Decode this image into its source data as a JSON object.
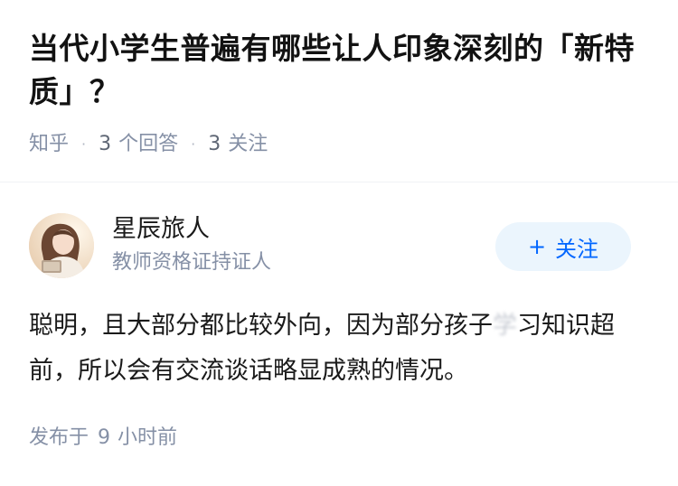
{
  "question": {
    "title": "当代小学生普遍有哪些让人印象深刻的「新特质」？",
    "source": "知乎",
    "answer_count": "3",
    "answer_label": "个回答",
    "follower_count": "3",
    "follower_label": "关注"
  },
  "author": {
    "name": "星辰旅人",
    "bio": "教师资格证持证人",
    "follow_label": "关注",
    "follow_icon": "plus-icon"
  },
  "answer": {
    "text_part1": "聪明，且大部分都比较外向，因为部分孩子",
    "text_blurred": "学",
    "text_part2": "习知识超前，所以会有交流谈话略显成熟的情况。",
    "published_prefix": "发布于",
    "published_num": "9",
    "published_suffix": "小时前"
  },
  "colors": {
    "accent": "#0066ff",
    "follow_bg": "#ebf5fd",
    "meta_gray": "#8590a6"
  }
}
